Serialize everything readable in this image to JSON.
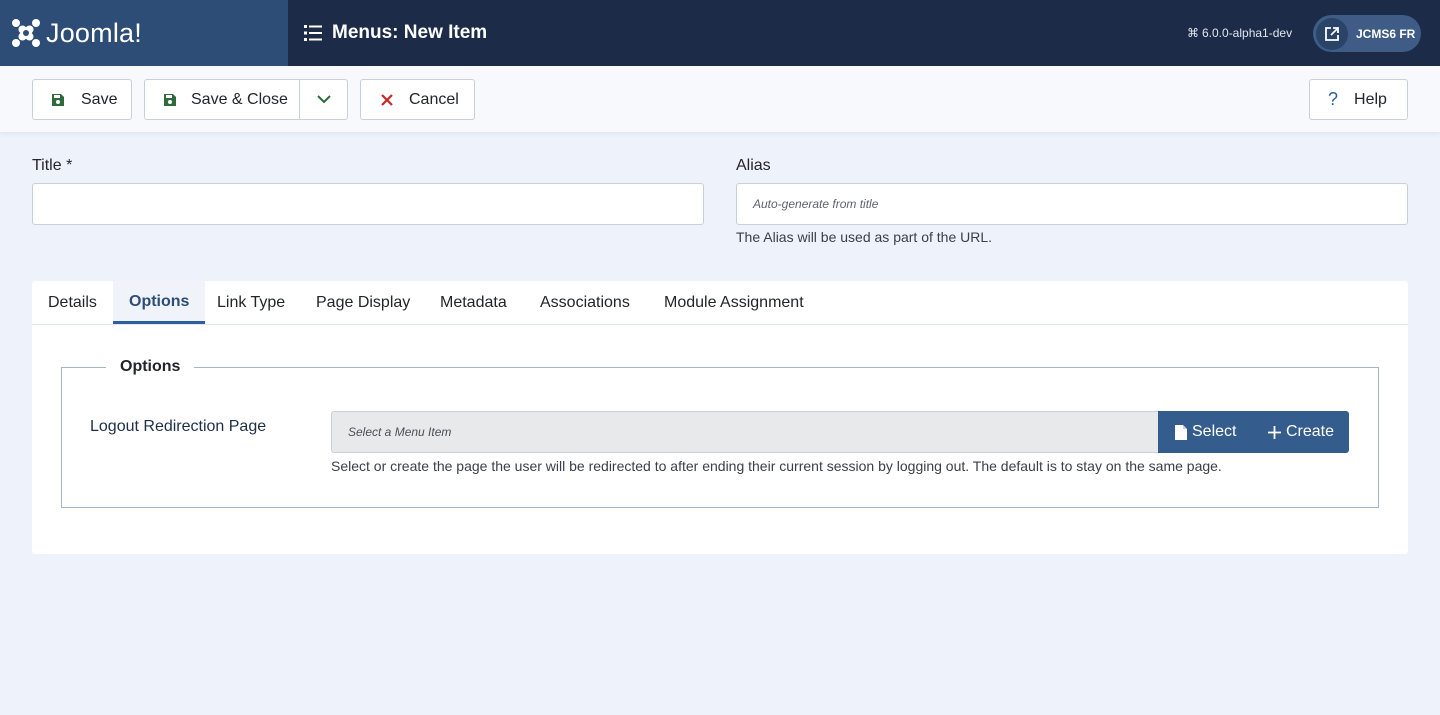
{
  "brand": {
    "name": "Joomla!",
    "logo_icon": "joomla-logo-icon"
  },
  "header": {
    "title": "Menus: New Item",
    "title_icon": "list-icon",
    "version_icon": "command-icon",
    "version": "6.0.0-alpha1-dev",
    "site_button_label": "JCMS6 FR",
    "site_button_icon": "external-link-icon"
  },
  "toolbar": {
    "save_label": "Save",
    "save_close_label": "Save & Close",
    "cancel_label": "Cancel",
    "help_label": "Help",
    "help_icon_glyph": "?"
  },
  "form": {
    "title_label": "Title *",
    "title_value": "",
    "alias_label": "Alias",
    "alias_placeholder": "Auto-generate from title",
    "alias_help": "The Alias will be used as part of the URL."
  },
  "tabs": [
    {
      "label": "Details"
    },
    {
      "label": "Options",
      "active": true
    },
    {
      "label": "Link Type"
    },
    {
      "label": "Page Display"
    },
    {
      "label": "Metadata"
    },
    {
      "label": "Associations"
    },
    {
      "label": "Module Assignment"
    }
  ],
  "options": {
    "legend": "Options",
    "logout_label": "Logout Redirection Page",
    "select_placeholder": "Select a Menu Item",
    "select_button": "Select",
    "create_button": "Create",
    "help": "Select or create the page the user will be redirected to after ending their current session by logging out. The default is to stay on the same page."
  },
  "colors": {
    "header_bg": "#1c2c48",
    "brand_bg": "#2e4d76",
    "page_bg": "#eef3fb",
    "primary_button": "#345c8c",
    "save_icon": "#2f6b3a",
    "cancel_icon": "#c52827"
  }
}
